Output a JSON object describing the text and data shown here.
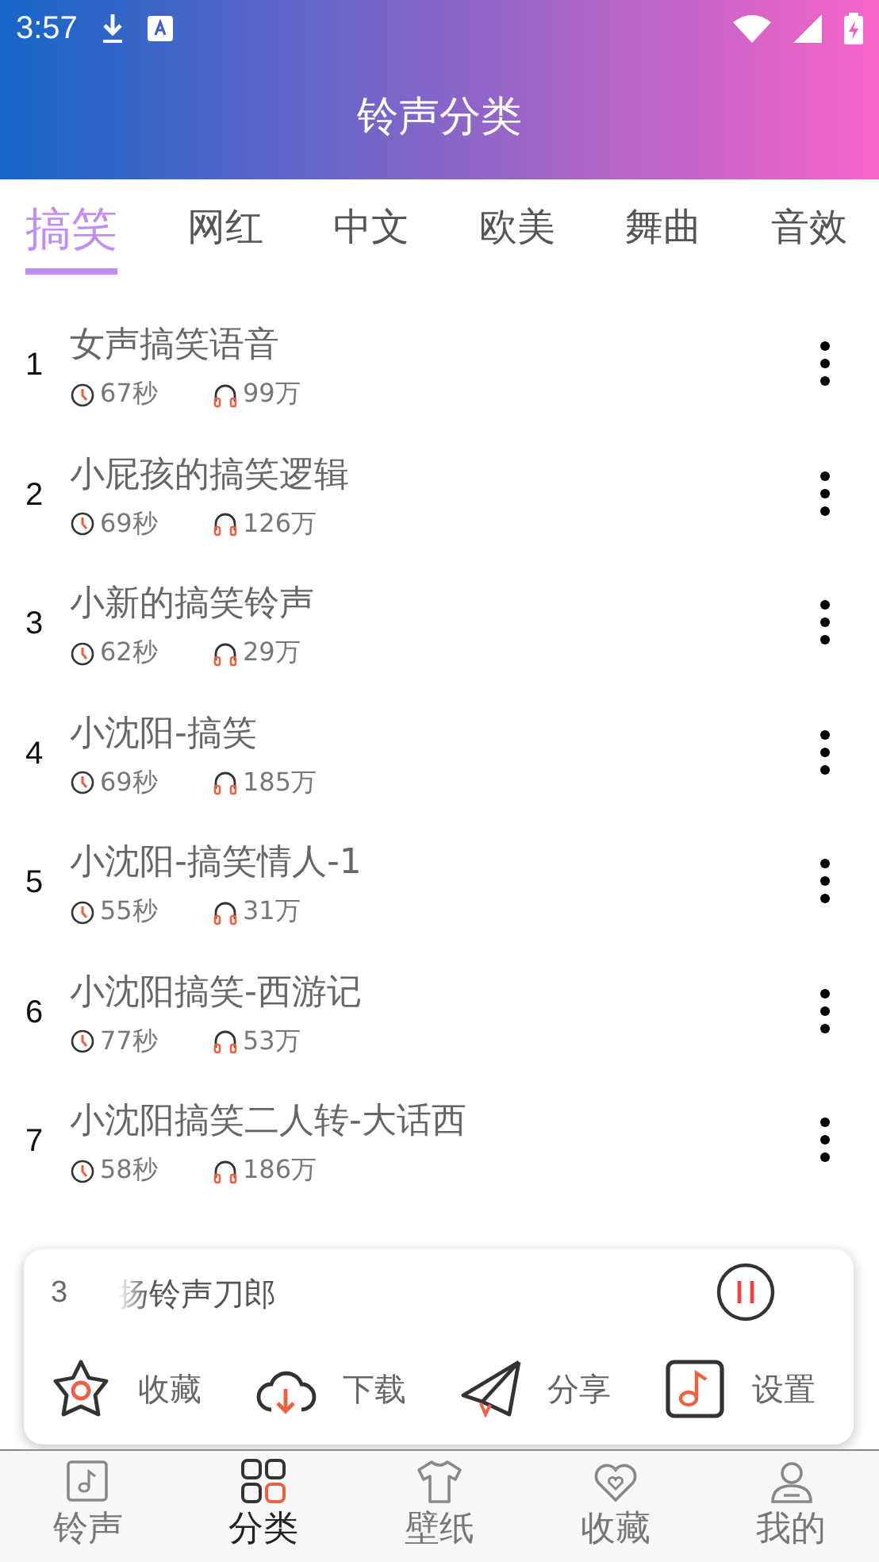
{
  "status_bar": {
    "time": "3:57"
  },
  "header": {
    "title": "铃声分类"
  },
  "tabs": [
    {
      "label": "搞笑",
      "selected": true
    },
    {
      "label": "网红",
      "selected": false
    },
    {
      "label": "中文",
      "selected": false
    },
    {
      "label": "欧美",
      "selected": false
    },
    {
      "label": "舞曲",
      "selected": false
    },
    {
      "label": "音效",
      "selected": false
    }
  ],
  "ringtones": [
    {
      "rank": "1",
      "title": "女声搞笑语音",
      "duration": "67秒",
      "plays": "99万"
    },
    {
      "rank": "2",
      "title": "小屁孩的搞笑逻辑",
      "duration": "69秒",
      "plays": "126万"
    },
    {
      "rank": "3",
      "title": "小新的搞笑铃声",
      "duration": "62秒",
      "plays": "29万"
    },
    {
      "rank": "4",
      "title": "小沈阳-搞笑",
      "duration": "69秒",
      "plays": "185万"
    },
    {
      "rank": "5",
      "title": "小沈阳-搞笑情人-1",
      "duration": "55秒",
      "plays": "31万"
    },
    {
      "rank": "6",
      "title": "小沈阳搞笑-西游记",
      "duration": "77秒",
      "plays": "53万"
    },
    {
      "rank": "7",
      "title": "小沈阳搞笑二人转-大话西",
      "duration": "58秒",
      "plays": "186万"
    }
  ],
  "player": {
    "index": "3",
    "title": "扬铃声刀郎",
    "playing": true,
    "actions": [
      {
        "kind": "favorite",
        "label": "收藏"
      },
      {
        "kind": "download",
        "label": "下载"
      },
      {
        "kind": "share",
        "label": "分享"
      },
      {
        "kind": "settings",
        "label": "设置"
      }
    ]
  },
  "bottom_nav": [
    {
      "kind": "ringtone",
      "label": "铃声",
      "selected": false
    },
    {
      "kind": "category",
      "label": "分类",
      "selected": true
    },
    {
      "kind": "wallpaper",
      "label": "壁纸",
      "selected": false
    },
    {
      "kind": "favorite",
      "label": "收藏",
      "selected": false
    },
    {
      "kind": "profile",
      "label": "我的",
      "selected": false
    }
  ]
}
